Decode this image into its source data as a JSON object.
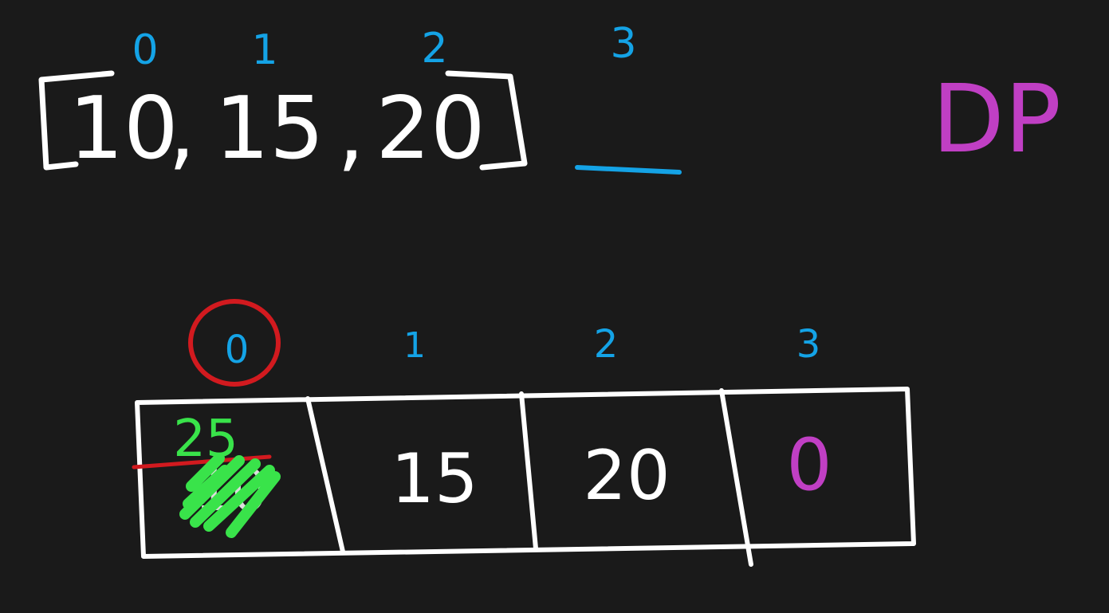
{
  "colors": {
    "background": "#1a1a1a",
    "white": "#ffffff",
    "blue": "#14a3e6",
    "magenta": "#c03fc4",
    "red": "#d21a1f",
    "green": "#39e34a"
  },
  "array": {
    "indices": [
      "0",
      "1",
      "2",
      "3"
    ],
    "values": [
      "10",
      "15",
      "20"
    ],
    "separators": [
      ",",
      ","
    ]
  },
  "label": {
    "dp": "DP"
  },
  "table": {
    "indices": [
      "0",
      "1",
      "2",
      "3"
    ],
    "cells": [
      {
        "value": "10",
        "updated": "25",
        "crossed_out": true
      },
      {
        "value": "15"
      },
      {
        "value": "20"
      },
      {
        "value": "0"
      }
    ]
  }
}
